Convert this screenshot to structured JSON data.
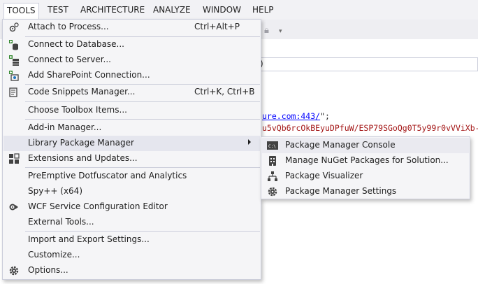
{
  "menubar": {
    "items": [
      "TOOLS",
      "TEST",
      "ARCHITECTURE",
      "ANALYZE",
      "WINDOW",
      "HELP"
    ],
    "active": "TOOLS"
  },
  "editor": {
    "paren": ")",
    "code_line1_url": "ure.com:443/",
    "code_line1_tail": "\";",
    "code_line2": "u5vQb6rcOkBEyuDPfuW/ESP79SGoQg0T5y99r0vVViXb-"
  },
  "tools_menu": {
    "items": [
      {
        "label": "Attach to Process...",
        "shortcut": "Ctrl+Alt+P",
        "icon": "attach-process-icon"
      },
      {
        "label": "Connect to Database...",
        "icon": "connect-database-icon"
      },
      {
        "label": "Connect to Server...",
        "icon": "connect-server-icon"
      },
      {
        "label": "Add SharePoint Connection...",
        "icon": "sharepoint-icon"
      },
      {
        "label": "Code Snippets Manager...",
        "shortcut": "Ctrl+K, Ctrl+B",
        "icon": "snippets-icon"
      },
      {
        "label": "Choose Toolbox Items..."
      },
      {
        "label": "Add-in Manager..."
      },
      {
        "label": "Library Package Manager",
        "submenu": true
      },
      {
        "label": "Extensions and Updates...",
        "icon": "extensions-icon"
      },
      {
        "label": "PreEmptive Dotfuscator and Analytics"
      },
      {
        "label": "Spy++ (x64)"
      },
      {
        "label": "WCF Service Configuration Editor",
        "icon": "wcf-config-icon"
      },
      {
        "label": "External Tools..."
      },
      {
        "label": "Import and Export Settings..."
      },
      {
        "label": "Customize..."
      },
      {
        "label": "Options...",
        "icon": "gear-icon"
      }
    ]
  },
  "package_submenu": {
    "items": [
      {
        "label": "Package Manager Console",
        "icon": "console-icon"
      },
      {
        "label": "Manage NuGet Packages for Solution...",
        "icon": "nuget-icon"
      },
      {
        "label": "Package Visualizer",
        "icon": "hierarchy-icon"
      },
      {
        "label": "Package Manager Settings",
        "icon": "gear-icon"
      }
    ]
  },
  "colors": {
    "menu_bg": "#f5f5f7",
    "menu_border": "#cccedb",
    "highlight": "#e5e6ee",
    "code_string": "#a31515",
    "code_url": "#0000ff"
  }
}
